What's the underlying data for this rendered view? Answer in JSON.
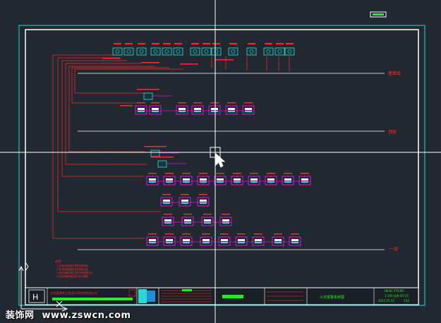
{
  "colors": {
    "background": "#212830",
    "grid": "#2c3540",
    "frame_outer": "#2ad6d6",
    "frame_inner": "#ffffff",
    "wiring": "#ff2a2a",
    "component": "#e010e0",
    "device_cyan": "#36e0e0",
    "crosshair": "#ffffff",
    "title_green": "#22ee22"
  },
  "floor_labels": [
    {
      "id": "roof",
      "text": "屋面层"
    },
    {
      "id": "upper",
      "text": "顶层"
    },
    {
      "id": "first",
      "text": "一层"
    }
  ],
  "title_block": {
    "company": "江苏某建筑工程设计研究院有限公司",
    "drawing_name": "火灾报警系统图",
    "drawing_no": "HK-EC-YT03PC",
    "scale": "1:100 比例 DT-10",
    "date": "2011.07.22",
    "sheet": "C03"
  },
  "notes": {
    "title": "说明:",
    "lines": [
      "1.本系统采用集中报警控制系统。",
      "2.联动控制线路采用阻燃耐火型。",
      "3.消防设备电源由消防专用回路引出。",
      "4.所有设备安装高度详见平面图。"
    ]
  },
  "watermark": {
    "brand": "装饰网",
    "url": "www.zswcn.com"
  },
  "cursor": {
    "icon": "crosshair-cursor-icon"
  }
}
